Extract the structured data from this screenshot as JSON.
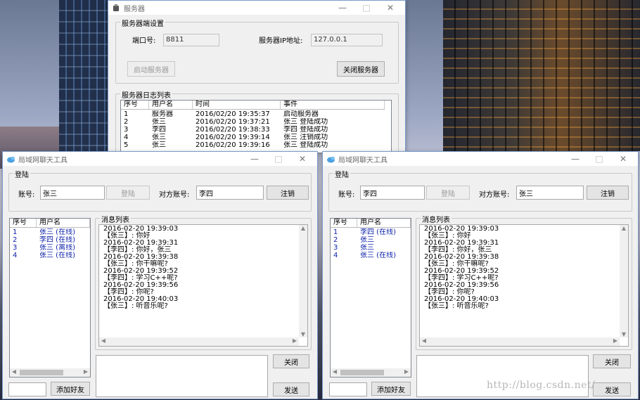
{
  "server": {
    "title": "服务器",
    "settings": {
      "group_label": "服务器端设置",
      "port_label": "端口号:",
      "port_value": "8811",
      "ip_label": "服务器IP地址:",
      "ip_value": "127.0.0.1",
      "start_label": "启动服务器",
      "stop_label": "关闭服务器"
    },
    "log": {
      "group_label": "服务器日志列表",
      "columns": [
        "序号",
        "用户名",
        "时间",
        "事件"
      ],
      "rows": [
        [
          "1",
          "服务器",
          "2016/02/20 19:35:37",
          "启动服务器"
        ],
        [
          "2",
          "张三",
          "2016/02/20 19:37:21",
          "张三 登陆成功"
        ],
        [
          "3",
          "李四",
          "2016/02/20 19:38:33",
          "李四 登陆成功"
        ],
        [
          "4",
          "张三",
          "2016/02/20 19:39:14",
          "张三 注销成功"
        ],
        [
          "5",
          "张三",
          "2016/02/20 19:39:16",
          "张三 登陆成功"
        ]
      ]
    }
  },
  "chat_left": {
    "title": "局域网聊天工具",
    "login_group": "登陆",
    "account_label": "账号:",
    "account_value": "张三",
    "login_button": "登陆",
    "peer_label": "对方账号:",
    "peer_value": "李四",
    "logout_button": "注销",
    "user_columns": [
      "序号",
      "用户名"
    ],
    "users": [
      [
        "1",
        "张三 (在线)"
      ],
      [
        "2",
        "李四 (在线)"
      ],
      [
        "3",
        "张三 (离线)"
      ],
      [
        "4",
        "张三 (在线)"
      ]
    ],
    "messages_label": "消息列表",
    "messages": [
      "2016-02-20 19:39:03",
      "【张三】: 你好",
      "2016-02-20 19:39:31",
      "【李四】: 你好，张三",
      "2016-02-20 19:39:38",
      "【张三】: 你干嘛呢?",
      "2016-02-20 19:39:52",
      "【李四】: 学习C++呢?",
      "2016-02-20 19:39:56",
      "【李四】: 你呢?",
      "2016-02-20 19:40:03",
      "【张三】: 听音乐呢?"
    ],
    "close_button": "关闭",
    "send_button": "发送",
    "add_friend_button": "添加好友"
  },
  "chat_right": {
    "title": "局域网聊天工具",
    "login_group": "登陆",
    "account_label": "账号:",
    "account_value": "李四",
    "login_button": "登陆",
    "peer_label": "对方账号:",
    "peer_value": "张三",
    "logout_button": "注销",
    "user_columns": [
      "序号",
      "用户名"
    ],
    "users": [
      [
        "1",
        "李四 (在线)"
      ],
      [
        "2",
        "张三"
      ],
      [
        "3",
        "张三"
      ],
      [
        "4",
        "张三 (在线)"
      ]
    ],
    "messages_label": "消息列表",
    "messages": [
      "2016-02-20 19:39:03",
      "【张三】: 你好",
      "2016-02-20 19:39:31",
      "【李四】: 你好，张三",
      "2016-02-20 19:39:38",
      "【张三】: 你干嘛呢?",
      "2016-02-20 19:39:52",
      "【李四】: 学习C++呢?",
      "2016-02-20 19:39:56",
      "【李四】: 你呢?",
      "2016-02-20 19:40:03",
      "【张三】: 听音乐呢?"
    ],
    "close_button": "关闭",
    "send_button": "发送",
    "add_friend_button": "添加好友"
  },
  "watermark": "http://blog.csdn.net/",
  "icons": {
    "server_app": "server-app-icon",
    "chat_app": "chat-bird-icon",
    "minimize": "minimize-icon",
    "maximize": "maximize-icon",
    "close": "close-icon"
  },
  "colors": {
    "online_text": "#0a1fa8",
    "window_bg": "#f0f0f0",
    "title_text": "#6b6b6b"
  }
}
